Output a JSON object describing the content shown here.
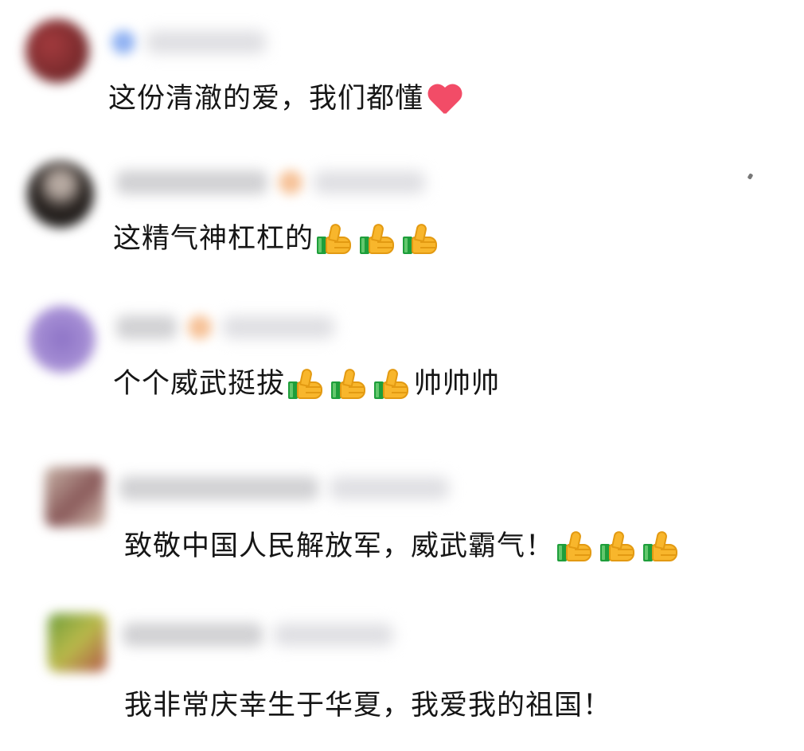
{
  "comments": [
    {
      "text": "这份清澈的爱，我们都懂",
      "emoji": "heart-icon"
    },
    {
      "text": "这精气神杠杠的",
      "emoji": "thumbs-up-icon x3"
    },
    {
      "text": "个个威武挺拔",
      "emoji": "thumbs-up-icon x3",
      "suffix": "帅帅帅"
    },
    {
      "text": "致敬中国人民解放军，威武霸气！",
      "emoji": "thumbs-up-icon x3"
    },
    {
      "text": "我非常庆幸生于华夏，我爱我的祖国！"
    }
  ],
  "colors": {
    "background": "#ffffff",
    "text": "#161616",
    "heart": "#f24c67",
    "thumb": "#f8b62c",
    "thumb_cuff": "#1e9e3b"
  }
}
